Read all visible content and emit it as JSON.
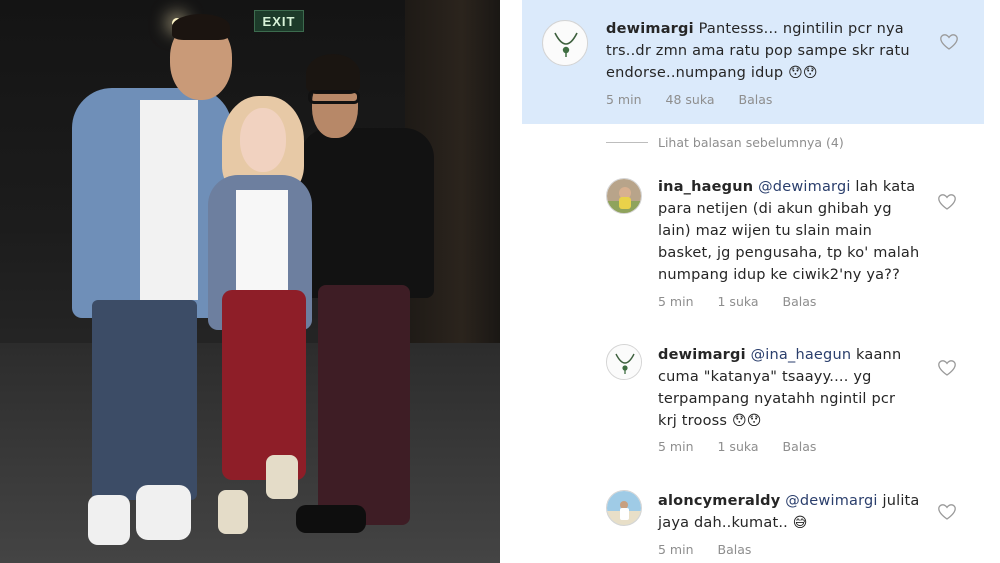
{
  "photo": {
    "exit_sign": "EXIT"
  },
  "comments": [
    {
      "username": "dewimargi",
      "text_parts": [
        "Pantesss... ngintilin pcr nya",
        "trs..dr zmn ama ratu pop sampe skr ratu",
        "endorse..numpang idup"
      ],
      "emoji": "😯😯",
      "time": "5 min",
      "likes": "48 suka",
      "reply": "Balas",
      "avatar_icon": "necklace-avatar-icon"
    },
    {
      "username": "ina_haegun",
      "mention": "@dewimargi",
      "text_parts": [
        "lah kata",
        "para netijen (di akun ghibah yg",
        "lain) maz wijen tu slain main",
        "basket, jg pengusaha, tp ko' malah",
        "numpang idup ke ciwik2'ny ya??"
      ],
      "time": "5 min",
      "likes": "1 suka",
      "reply": "Balas",
      "avatar_icon": "child-photo-avatar-icon"
    },
    {
      "username": "dewimargi",
      "mention": "@ina_haegun",
      "text_parts": [
        "kaann",
        "cuma \"katanya\" tsaayy.... yg",
        "terpampang nyatahh ngintil pcr",
        "krj trooss"
      ],
      "emoji": "😯😯",
      "time": "5 min",
      "likes": "1 suka",
      "reply": "Balas",
      "avatar_icon": "necklace-avatar-icon"
    },
    {
      "username": "aloncymeraldy",
      "mention": "@dewimargi",
      "text_parts": [
        "julita",
        "jaya dah..kumat.."
      ],
      "emoji": "😅",
      "time": "5 min",
      "reply": "Balas",
      "avatar_icon": "beach-photo-avatar-icon"
    }
  ],
  "view_replies": "Lihat balasan sebelumnya (4)",
  "colors": {
    "highlight": "#dbeafb",
    "mention": "#2a3e6c",
    "meta": "#8e8e8e"
  }
}
